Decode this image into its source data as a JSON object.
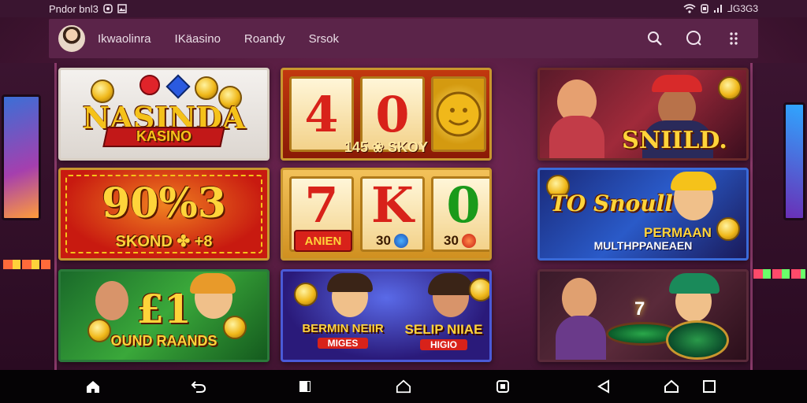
{
  "status_bar": {
    "left_text": "Pndor bnl3",
    "right_text": "⅃G3G3"
  },
  "header": {
    "nav": [
      "Ikwaolinra",
      "IKäasino",
      "Roandy",
      "Srsok"
    ]
  },
  "tiles": [
    {
      "title": "NASINDA",
      "subtitle": "KASINO"
    },
    {
      "reels": [
        "4",
        "0"
      ],
      "caption": "145 ❀ SKOY"
    },
    {
      "title": "SNIILD."
    },
    {
      "title": "90%3",
      "subtitle": "SKOND ✤ +8"
    },
    {
      "reels": [
        "7",
        "K",
        "0"
      ],
      "caption": "ANIEN",
      "badge_a": "30",
      "badge_b": "30"
    },
    {
      "title": "TO Snoull",
      "subtitle": "PERMAAN",
      "caption": "MULTHPPANEAEN"
    },
    {
      "title": "£1",
      "subtitle": "OUND RAANDS"
    },
    {
      "title": "BERMIN NEIIR",
      "subtitle": "MIGES",
      "title2": "SELIP NIIAE",
      "subtitle2": "HIGIO"
    },
    {
      "title": "7"
    }
  ],
  "colors": {
    "background": "#4a1838",
    "header": "#5b2449",
    "gold": "#f0b81a",
    "red": "#d8221a"
  }
}
